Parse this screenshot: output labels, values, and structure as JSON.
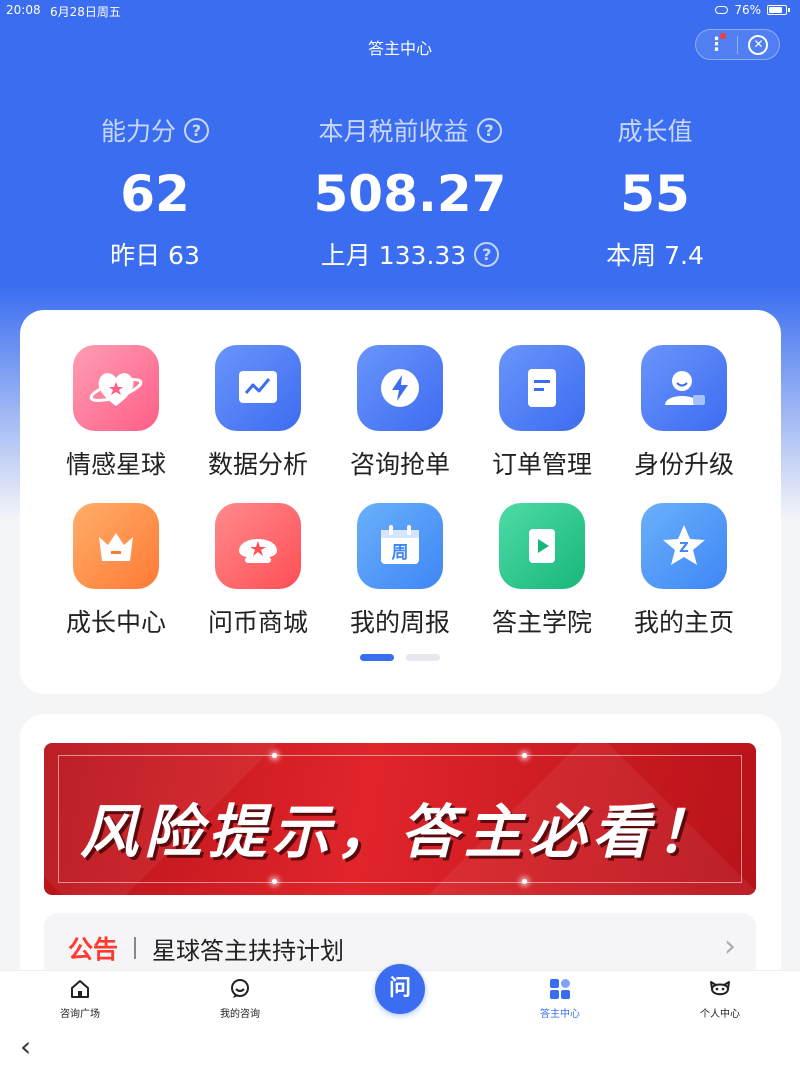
{
  "status": {
    "time": "20:08",
    "date": "6月28日周五",
    "battery": "76%"
  },
  "header": {
    "title": "答主中心"
  },
  "stats": [
    {
      "label": "能力分",
      "value": "62",
      "sub": "昨日 63",
      "help": true
    },
    {
      "label": "本月税前收益",
      "value": "508.27",
      "sub": "上月 133.33",
      "help": true
    },
    {
      "label": "成长值",
      "value": "55",
      "sub": "本周 7.4",
      "help": false
    }
  ],
  "grid": [
    {
      "label": "情感星球",
      "icon": "heart-planet-icon",
      "color": "#ff6f8f"
    },
    {
      "label": "数据分析",
      "icon": "chart-icon",
      "color": "#4a7cf7"
    },
    {
      "label": "咨询抢单",
      "icon": "lightning-icon",
      "color": "#4a7cf7"
    },
    {
      "label": "订单管理",
      "icon": "document-icon",
      "color": "#4a7cf7"
    },
    {
      "label": "身份升级",
      "icon": "user-badge-icon",
      "color": "#4a7cf7"
    },
    {
      "label": "成长中心",
      "icon": "crown-icon",
      "color": "#ff8a3d"
    },
    {
      "label": "问币商城",
      "icon": "shell-star-icon",
      "color": "#ff5a5f"
    },
    {
      "label": "我的周报",
      "icon": "calendar-icon",
      "color": "#3f93f5",
      "glyph": "周"
    },
    {
      "label": "答主学院",
      "icon": "play-icon",
      "color": "#22c58b"
    },
    {
      "label": "我的主页",
      "icon": "star-icon",
      "color": "#3f93f5"
    }
  ],
  "banner": {
    "text": "风险提示，答主必看！"
  },
  "notice": {
    "tag": "公告",
    "text": "星球答主扶持计划"
  },
  "tabbar": {
    "items": [
      {
        "label": "咨询广场",
        "icon": "home-icon"
      },
      {
        "label": "我的咨询",
        "icon": "chat-icon"
      },
      {
        "label": "答主中心",
        "icon": "apps-icon",
        "active": true
      },
      {
        "label": "个人中心",
        "icon": "face-icon"
      }
    ],
    "ask_label": "问"
  },
  "colors": {
    "accent": "#3a6df0",
    "alert": "#ff3b30"
  }
}
